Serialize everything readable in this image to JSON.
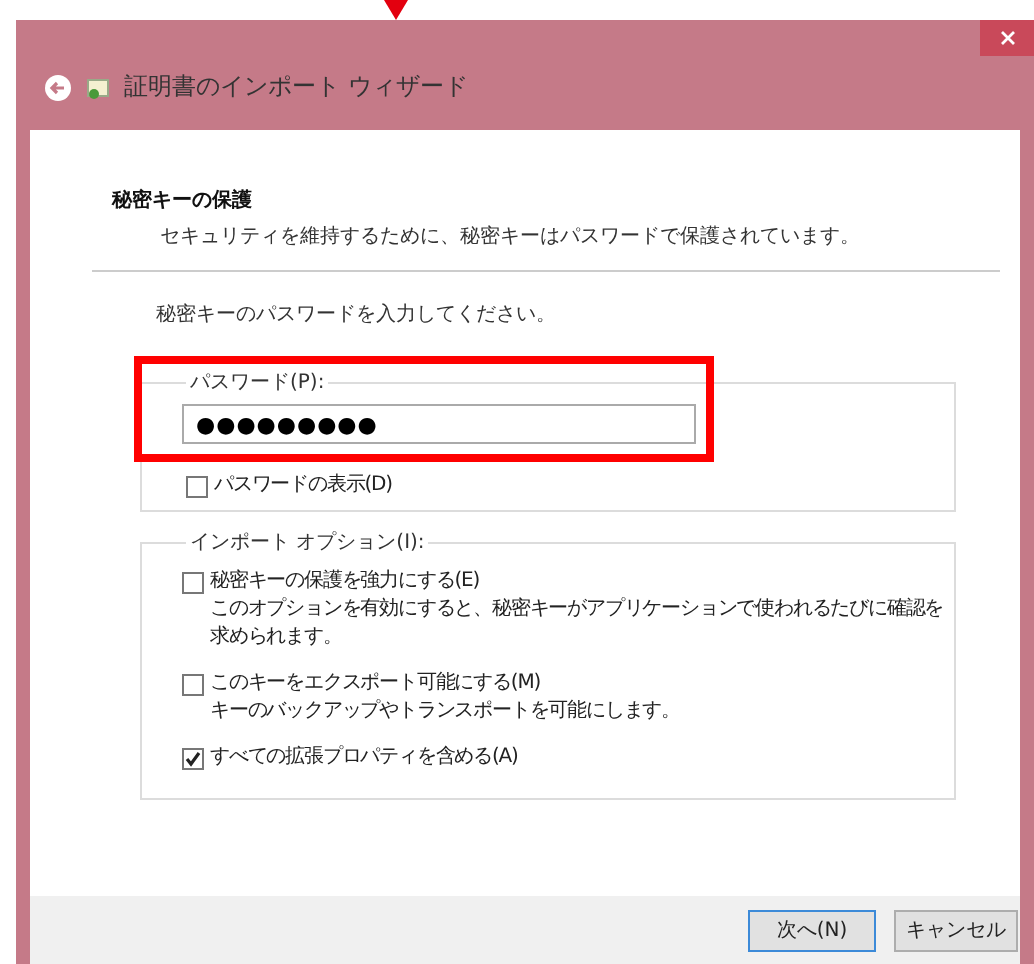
{
  "window": {
    "title": "証明書のインポート ウィザード"
  },
  "page": {
    "heading": "秘密キーの保護",
    "description": "セキュリティを維持するために、秘密キーはパスワードで保護されています。"
  },
  "prompt": "秘密キーのパスワードを入力してください。",
  "password_group": {
    "label": "パスワード(P):",
    "value": "●●●●●●●●●",
    "show_password": {
      "label": "パスワードの表示(D)",
      "checked": false
    }
  },
  "import_options": {
    "label": "インポート オプション(I):",
    "options": [
      {
        "label": "秘密キーの保護を強力にする(E)",
        "description": "このオプションを有効にすると、秘密キーがアプリケーションで使われるたびに確認を求められます。",
        "checked": false
      },
      {
        "label": "このキーをエクスポート可能にする(M)",
        "description": "キーのバックアップやトランスポートを可能にします。",
        "checked": false
      },
      {
        "label": "すべての拡張プロパティを含める(A)",
        "checked": true
      }
    ]
  },
  "buttons": [
    {
      "label": "次へ(N)",
      "default": true
    },
    {
      "label": "キャンセル",
      "default": false
    }
  ]
}
